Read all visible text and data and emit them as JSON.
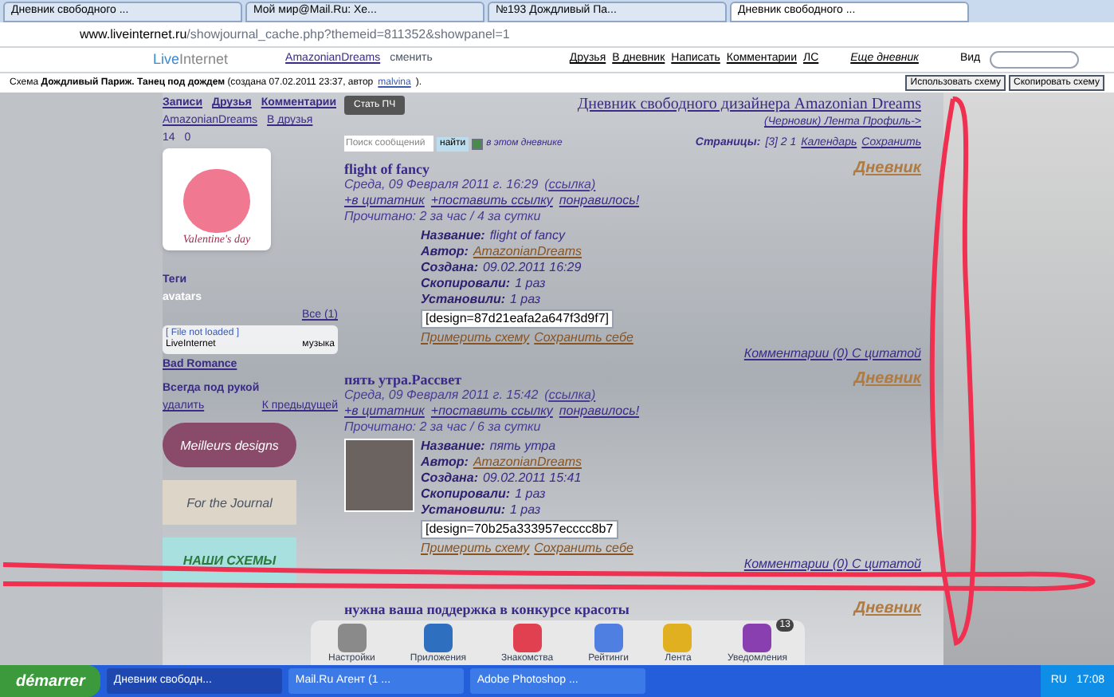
{
  "browser": {
    "tabs": [
      {
        "label": "Дневник свободного ...",
        "selected": false
      },
      {
        "label": "Мой мир@Mail.Ru: Хе...",
        "selected": false
      },
      {
        "label": "№193 Дождливый Па...",
        "selected": false
      },
      {
        "label": "Дневник свободного ...",
        "selected": true
      }
    ],
    "address": {
      "host": "www.liveinternet.ru",
      "path": "/showjournal_cache.php?themeid=811352&showpanel=1"
    }
  },
  "site_bar": {
    "logo": {
      "first": "Live",
      "second": "Internet"
    },
    "user": "AmazonianDreams",
    "user_note": "сменить",
    "links": [
      "Друзья",
      "В дневник",
      "Написать",
      "Комментарии",
      "ЛС"
    ],
    "more": "Еще дневник",
    "view": "Вид"
  },
  "scheme_line": {
    "prefix": "Схема",
    "name": "Дождливый Париж. Танец под дождем",
    "info": "(создана 07.02.2011 23:37, автор",
    "author": "malvina",
    "suffix": ").",
    "buttons": [
      "Использовать схему",
      "Скопировать схему"
    ]
  },
  "sidebar": {
    "nav": [
      "Записи",
      "Друзья",
      "Комментарии"
    ],
    "user": "AmazonianDreams",
    "friends": "В друзья",
    "counts": [
      "14",
      "0"
    ],
    "avatar_caption": "Valentine's day",
    "tags": "Теги",
    "tag_label": "avatars",
    "all_link": "Все (1)",
    "player": {
      "status": "[ File not loaded ]",
      "left": "LiveInternet",
      "right": "музыка"
    },
    "music_title": "Bad Romance",
    "handy": "Всегда под рукой",
    "handy_left": "удалить",
    "handy_right": "К предыдущей"
  },
  "header": {
    "become_pch": "Стать ПЧ",
    "title": "Дневник свободного дизайнера Amazonian Dreams",
    "sublinks": "(Черновик) Лента Профиль->",
    "search_placeholder": "Поиск сообщений",
    "search_button": "найти",
    "search_scope": "в этом дневнике",
    "search_scope_checked": true,
    "pages_label": "Страницы:",
    "pages": "[3] 2 1",
    "calendar": "Календарь",
    "save": "Сохранить"
  },
  "posts": [
    {
      "tag": "Дневник",
      "title": "flight of fancy",
      "date": "Среда, 09 Февраля 2011 г. 16:29",
      "link": "(ссылка)",
      "actions": [
        "+в цитатник",
        "+поставить ссылку",
        "понравилось!"
      ],
      "reads": "Прочитано: 2 за час / 4 за сутки",
      "fields": [
        {
          "label": "Название:",
          "value": "flight of fancy"
        },
        {
          "label": "Автор:",
          "value": "AmazonianDreams"
        },
        {
          "label": "Создана:",
          "value": "09.02.2011 16:29"
        },
        {
          "label": "Скопировали:",
          "value": "1 раз"
        },
        {
          "label": "Установили:",
          "value": "1 раз"
        }
      ],
      "code": "[design=87d21eafa2a647f3d9f7]",
      "preview": "Примерить схему",
      "save": "Сохранить себе",
      "comments": "Комментарии (0) С цитатой"
    },
    {
      "tag": "Дневник",
      "title": "пять утра.Рассвет",
      "date": "Среда, 09 Февраля 2011 г. 15:42",
      "link": "(ссылка)",
      "actions": [
        "+в цитатник",
        "+поставить ссылку",
        "понравилось!"
      ],
      "reads": "Прочитано: 2 за час / 6 за сутки",
      "thumb": true,
      "fields": [
        {
          "label": "Название:",
          "value": "пять утра"
        },
        {
          "label": "Автор:",
          "value": "AmazonianDreams"
        },
        {
          "label": "Создана:",
          "value": "09.02.2011 15:41"
        },
        {
          "label": "Скопировали:",
          "value": "1 раз"
        },
        {
          "label": "Установили:",
          "value": "1 раз"
        }
      ],
      "code": "[design=70b25a333957ecccc8b7",
      "preview": "Примерить схему",
      "save": "Сохранить себе",
      "comments": "Комментарии (0) С цитатой"
    },
    {
      "tag": "Дневник",
      "title": "нужна ваша поддержка в конкурсе красоты"
    }
  ],
  "banners": [
    "Meilleurs designs",
    "For the Journal",
    "НАШИ СХЕМЫ"
  ],
  "dock": [
    {
      "label": "Настройки",
      "color": "#8a8a8a"
    },
    {
      "label": "Приложения",
      "color": "#2f6fc0"
    },
    {
      "label": "Знакомства",
      "color": "#e04050"
    },
    {
      "label": "Рейтинги",
      "color": "#4f7fe0"
    },
    {
      "label": "Лента",
      "color": "#e0b020"
    },
    {
      "label": "Уведомления",
      "color": "#8a3fb0",
      "badge": "13"
    }
  ],
  "taskbar": {
    "start": "démarrer",
    "items": [
      {
        "label": "Дневник свободн...",
        "selected": true
      },
      {
        "label": "Mail.Ru Агент (1 ...",
        "selected": false
      },
      {
        "label": "Adobe Photoshop ...",
        "selected": false
      }
    ],
    "lang": "RU",
    "time": "17:08"
  }
}
